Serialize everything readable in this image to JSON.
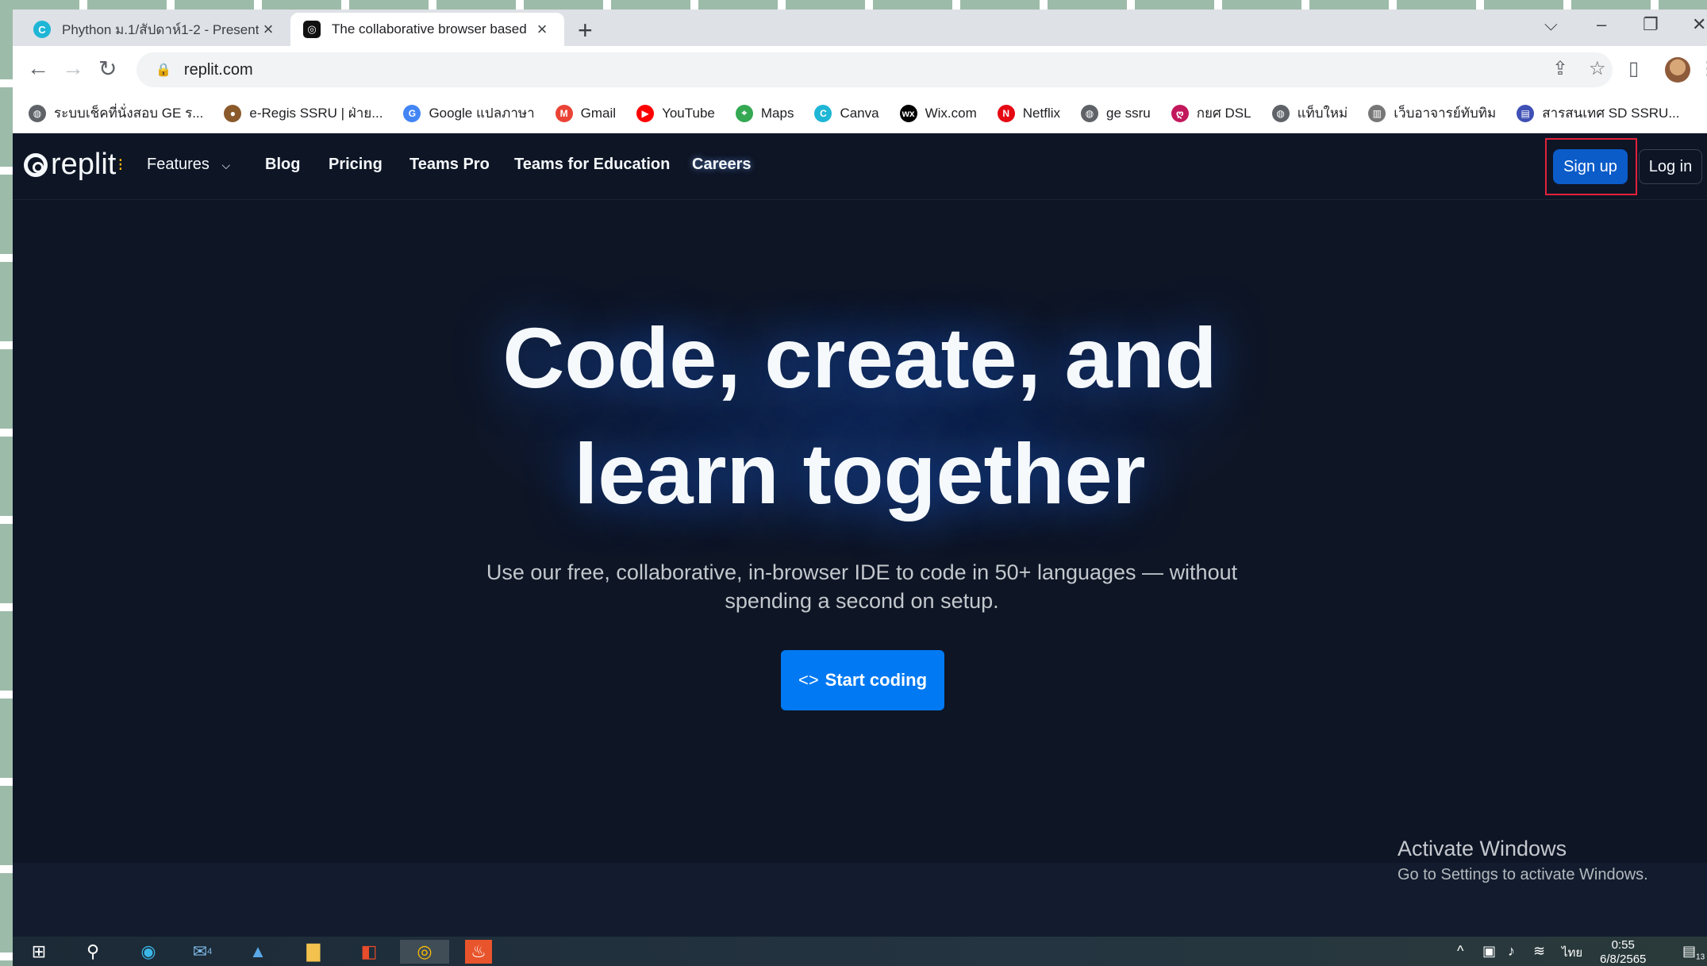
{
  "browser": {
    "tabs": [
      {
        "title": "Phython ม.1/สัปดาห์1-2 - Presenta",
        "favicon": "canva-icon"
      },
      {
        "title": "The collaborative browser based",
        "favicon": "replit-icon",
        "active": true
      }
    ],
    "new_tab": "+",
    "window_controls": {
      "tab_search": "⌵",
      "minimize": "–",
      "restore": "❐",
      "close": "✕"
    },
    "url": "replit.com"
  },
  "bookmarks": [
    {
      "label": "ระบบเช็คที่นั่งสอบ GE ร...",
      "icon": "globe-icon",
      "color": "#5f6368"
    },
    {
      "label": "e-Regis SSRU | ฝ่าย...",
      "icon": "ssru-icon",
      "color": "#8a5a2b"
    },
    {
      "label": "Google แปลภาษา",
      "icon": "translate-icon",
      "color": "#4285f4"
    },
    {
      "label": "Gmail",
      "icon": "gmail-icon",
      "color": "#ea4335"
    },
    {
      "label": "YouTube",
      "icon": "youtube-icon",
      "color": "#ff0000"
    },
    {
      "label": "Maps",
      "icon": "maps-icon",
      "color": "#34a853"
    },
    {
      "label": "Canva",
      "icon": "canva-icon",
      "color": "#1fb6d6"
    },
    {
      "label": "Wix.com",
      "icon": "wix-icon",
      "color": "#000000"
    },
    {
      "label": "Netflix",
      "icon": "netflix-icon",
      "color": "#e50914"
    },
    {
      "label": "ge ssru",
      "icon": "globe-icon",
      "color": "#5f6368"
    },
    {
      "label": "กยศ DSL",
      "icon": "dsl-icon",
      "color": "#c2185b"
    },
    {
      "label": "แท็บใหม่",
      "icon": "globe-icon",
      "color": "#5f6368"
    },
    {
      "label": "เว็บอาจารย์ทับทิม",
      "icon": "doc-icon",
      "color": "#777777"
    },
    {
      "label": "สารสนเทศ SD SSRU...",
      "icon": "forms-icon",
      "color": "#3f51b5"
    }
  ],
  "nav": {
    "logo": "replit",
    "features": "Features",
    "blog": "Blog",
    "pricing": "Pricing",
    "teams_pro": "Teams Pro",
    "teams_edu": "Teams for Education",
    "careers": "Careers",
    "sign_up": "Sign up",
    "log_in": "Log in"
  },
  "hero": {
    "line1": "Code, create, and",
    "line2": "learn together",
    "subtitle_line1": "Use our free, collaborative, in-browser IDE to code in 50+ languages — without",
    "subtitle_line2": "spending a second on setup.",
    "cta_icon": "<>",
    "cta": "Start coding"
  },
  "watermark": {
    "title": "Activate Windows",
    "subtitle": "Go to Settings to activate Windows."
  },
  "taskbar": {
    "mail_badge": "4",
    "language": "ไทย",
    "time": "0:55",
    "date": "6/8/2565",
    "notification_count": "13"
  },
  "colors": {
    "page_bg": "#0e1525",
    "primary_button": "#0079f2",
    "signup_button": "#0b5cc9",
    "highlight_box": "#e3213b"
  }
}
